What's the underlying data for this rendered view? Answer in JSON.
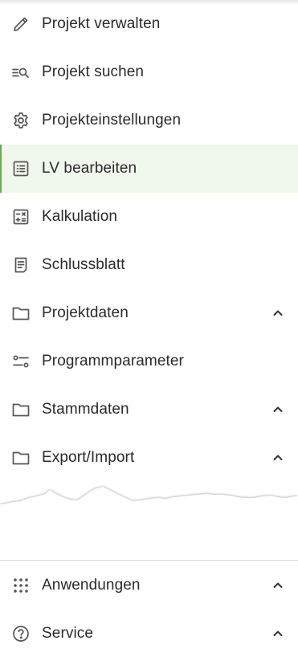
{
  "menu": {
    "items": [
      {
        "label": "Projekt verwalten",
        "icon": "pencil-icon",
        "expandable": false,
        "active": false
      },
      {
        "label": "Projekt suchen",
        "icon": "list-search-icon",
        "expandable": false,
        "active": false
      },
      {
        "label": "Projekteinstellungen",
        "icon": "gear-icon",
        "expandable": false,
        "active": false
      },
      {
        "label": "LV bearbeiten",
        "icon": "list-document-icon",
        "expandable": false,
        "active": true
      },
      {
        "label": "Kalkulation",
        "icon": "calculator-icon",
        "expandable": false,
        "active": false
      },
      {
        "label": "Schlussblatt",
        "icon": "document-icon",
        "expandable": false,
        "active": false
      },
      {
        "label": "Projektdaten",
        "icon": "folder-icon",
        "expandable": true,
        "active": false
      },
      {
        "label": "Programmparameter",
        "icon": "sliders-icon",
        "expandable": false,
        "active": false
      },
      {
        "label": "Stammdaten",
        "icon": "folder-icon",
        "expandable": true,
        "active": false
      },
      {
        "label": "Export/Import",
        "icon": "folder-icon",
        "expandable": true,
        "active": false
      }
    ]
  },
  "footer": {
    "items": [
      {
        "label": "Anwendungen",
        "icon": "apps-grid-icon",
        "expandable": true
      },
      {
        "label": "Service",
        "icon": "help-circle-icon",
        "expandable": true
      }
    ]
  },
  "colors": {
    "active_background": "#f0f7ec",
    "active_accent": "#6aa84f",
    "icon": "#555555",
    "text": "#2a2a2a"
  }
}
